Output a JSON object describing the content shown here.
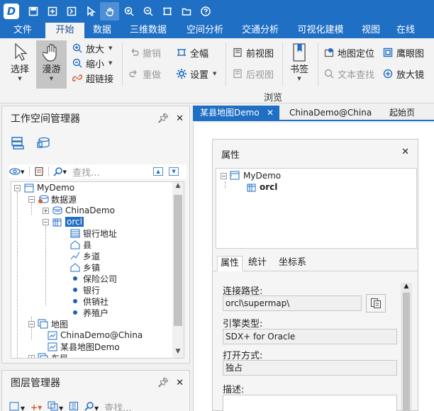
{
  "app": {
    "accent": "#1f6fc5"
  },
  "quick_access": [
    "logo-icon",
    "save-icon",
    "new-window-icon",
    "import-icon",
    "select-icon",
    "pan-icon",
    "zoom-in-icon",
    "zoom-out-icon",
    "full-extent-icon",
    "open-folder-icon",
    "help-icon"
  ],
  "ribbon_tabs": [
    "文件",
    "开始",
    "数据",
    "三维数据",
    "空间分析",
    "交通分析",
    "可视化建模",
    "视图",
    "在线"
  ],
  "ribbon": {
    "select": "选择",
    "pan": "漫游",
    "zoom_in": "放大",
    "zoom_out": "缩小",
    "hyperlink": "超链接",
    "undo": "撤销",
    "redo": "重做",
    "full_extent": "全幅",
    "settings": "设置",
    "prev_view": "前视图",
    "next_view": "后视图",
    "bookmark": "书签",
    "map_locate": "地图定位",
    "text_search": "文本查找",
    "eagle_eye": "鹰眼图",
    "magnifier": "放大镜",
    "group_browse": "浏览"
  },
  "workspace_panel": {
    "title": "工作空间管理器",
    "search_placeholder": "查找...",
    "tree": {
      "root": "MyDemo",
      "datasources": "数据源",
      "ds1": "ChinaDemo",
      "ds2": "orcl",
      "items": [
        "银行地址",
        "县",
        "乡道",
        "乡镇",
        "保险公司",
        "银行",
        "供销社",
        "养殖户"
      ],
      "maps": "地图",
      "map1": "ChinaDemo@China",
      "map2": "某县地图Demo",
      "layouts": "布局"
    }
  },
  "layer_panel": {
    "title": "图层管理器",
    "search_placeholder": "查找..."
  },
  "doc_tabs": [
    {
      "label": "某县地图Demo",
      "active": true
    },
    {
      "label": "ChinaDemo@China",
      "active": false
    },
    {
      "label": "起始页",
      "active": false
    }
  ],
  "properties": {
    "title": "属性",
    "tree_root": "MyDemo",
    "tree_child": "orcl",
    "tabs": [
      "属性",
      "统计",
      "坐标系"
    ],
    "connection_label": "连接路径:",
    "connection_value": "orcl\\supermap\\",
    "engine_label": "引擎类型:",
    "engine_value": "SDX+ for Oracle",
    "open_mode_label": "打开方式:",
    "open_mode_value": "独占",
    "desc_label": "描述:"
  }
}
